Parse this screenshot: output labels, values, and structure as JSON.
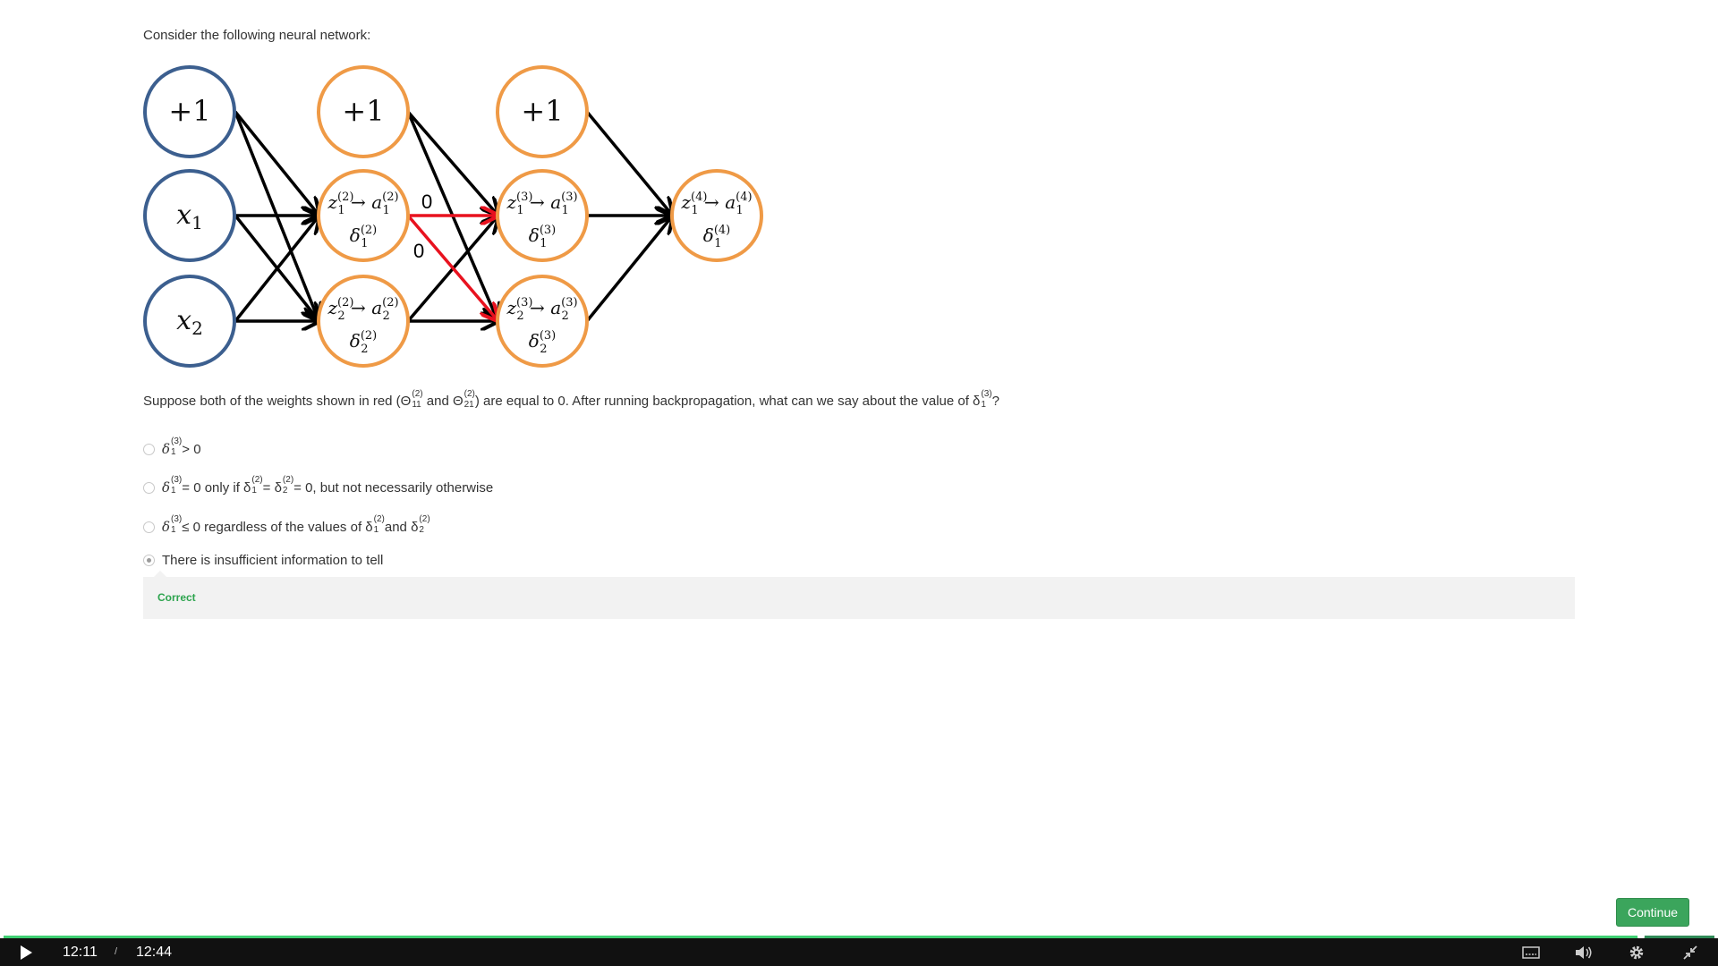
{
  "prompt": "Consider the following neural network:",
  "network": {
    "bias_label": "+1",
    "inputs": [
      "x1",
      "x2"
    ],
    "edge_labels": [
      "0",
      "0"
    ],
    "colors": {
      "input_stroke": "#3c5f8f",
      "hidden_stroke": "#ef9a46",
      "edge": "#000000",
      "highlight_edge": "#e8121f"
    }
  },
  "question": {
    "intro": "Suppose both of the weights shown in red (Θ",
    "theta1_sup": "(2)",
    "theta1_sub": "11",
    "and": " and Θ",
    "theta2_sup": "(2)",
    "theta2_sub": "21",
    "mid": ") are equal to 0. After running backpropagation, what can we say about the value of δ",
    "delta_sup": "(3)",
    "delta_sub": "1",
    "end": "?"
  },
  "options": [
    {
      "delta_sup": "(3)",
      "delta_sub": "1",
      "tail": " > 0",
      "selected": false
    },
    {
      "delta_sup": "(3)",
      "delta_sub": "1",
      "mid1": " = 0 only if δ",
      "d1_sup": "(2)",
      "d1_sub": "1",
      "mid2": " = δ",
      "d2_sup": "(2)",
      "d2_sub": "2",
      "tail": " = 0, but not necessarily otherwise",
      "selected": false
    },
    {
      "delta_sup": "(3)",
      "delta_sub": "1",
      "mid1": " ≤ 0 regardless of the values of δ",
      "d1_sup": "(2)",
      "d1_sub": "1",
      "mid2": " and δ",
      "d2_sup": "(2)",
      "d2_sub": "2",
      "tail": "",
      "selected": false
    },
    {
      "label": "There is insufficient information to tell",
      "selected": true
    }
  ],
  "feedback": "Correct",
  "continue_label": "Continue",
  "player": {
    "current_time": "12:11",
    "separator": "/",
    "duration": "12:44",
    "progress_fraction": 0.957,
    "icons": [
      "play-icon",
      "captions-icon",
      "volume-icon",
      "settings-icon",
      "exit-fullscreen-icon"
    ]
  }
}
